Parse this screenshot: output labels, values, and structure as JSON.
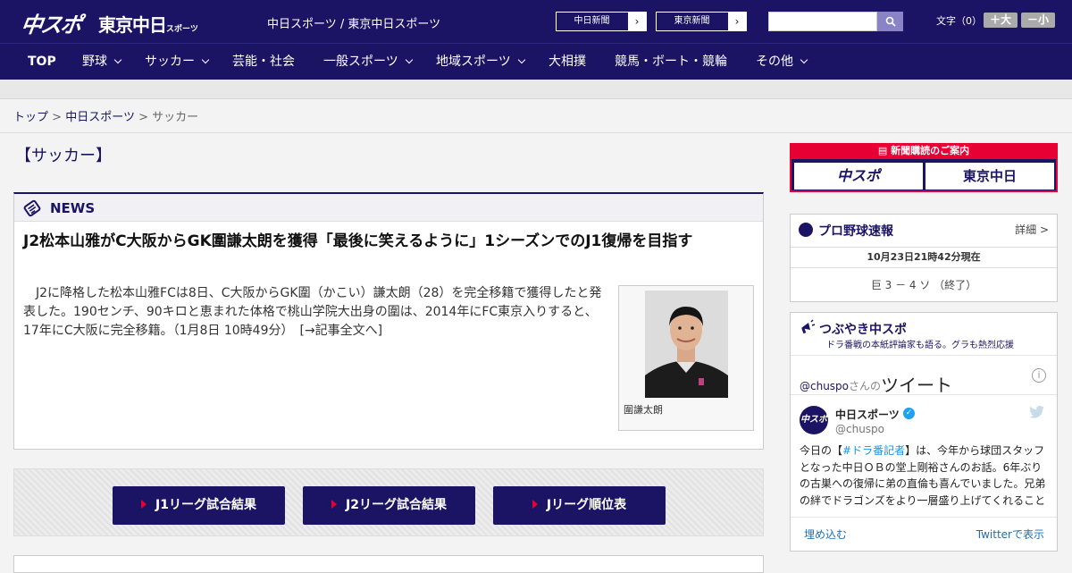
{
  "header": {
    "logo_main": "中スポ",
    "logo_tokyo": "東京中日",
    "logo_tokyo_small": "スポーツ",
    "tagline": "中日スポーツ / 東京中日スポーツ",
    "site_links": [
      "中日新聞",
      "東京新聞"
    ],
    "search_placeholder": "",
    "font_size_label": "文字（0）",
    "font_large": "＋大",
    "font_small": "－小"
  },
  "nav": {
    "items": [
      {
        "label": "TOP"
      },
      {
        "label": "野球"
      },
      {
        "label": "サッカー"
      },
      {
        "label": "芸能・社会"
      },
      {
        "label": "一般スポーツ"
      },
      {
        "label": "地域スポーツ"
      },
      {
        "label": "大相撲"
      },
      {
        "label": "競馬・ボート・競輪"
      },
      {
        "label": "その他"
      }
    ]
  },
  "breadcrumb": {
    "items": [
      "トップ",
      "中日スポーツ",
      "サッカー"
    ],
    "separator": ">"
  },
  "main": {
    "page_title": "【サッカー】",
    "news_label": "NEWS",
    "article": {
      "title": "J2松本山雅がC大阪からGK圍謙太朗を獲得「最後に笑えるように」1シーズンでのJ1復帰を目指す",
      "body": "J2に降格した松本山雅FCは8日、C大阪からGK圍（かこい）謙太朗（28）を完全移籍で獲得したと発表した。190センチ、90キロと恵まれた体格で桃山学院大出身の圍は、2014年にFC東京入りすると、17年にC大阪に完全移籍。（1月8日 10時49分）　[→記事全文へ]",
      "photo_caption": "圍謙太朗"
    },
    "links": [
      "J1リーグ試合結果",
      "J2リーグ試合結果",
      "Jリーグ順位表"
    ]
  },
  "sidebar": {
    "subscribe": {
      "title": "新聞購読のご案内",
      "logo1": "中スポ",
      "logo2": "東京中日"
    },
    "baseball": {
      "title": "プロ野球速報",
      "detail": "詳細 >",
      "time": "10月23日21時42分現在",
      "score": "巨 3 － 4 ソ （終了）"
    },
    "tweet": {
      "title": "つぶやき中スポ",
      "subtitle": "ドラ番戦の本紙評論家も語る。グラも熱烈応援",
      "handle": "@chuspo",
      "handle_suffix": "さんの",
      "heading": "ツイート",
      "name": "中日スポーツ",
      "user": "@chuspo",
      "avatar_text": "中スポ",
      "text_before": "今日の【",
      "text_tag": "#ドラ番記者",
      "text_after": "】は、今年から球団スタッフとなった中日ＯＢの堂上剛裕さんのお話。6年ぶりの古巣への復帰に弟の直倫も喜んでいました。兄弟の絆でドラゴンズをより一層盛り上げてくれること",
      "embed": "埋め込む",
      "view": "Twitterで表示"
    }
  },
  "colors": {
    "brand_navy": "#1b1464",
    "accent_red": "#e60033",
    "link_blue": "#1b95e0"
  }
}
